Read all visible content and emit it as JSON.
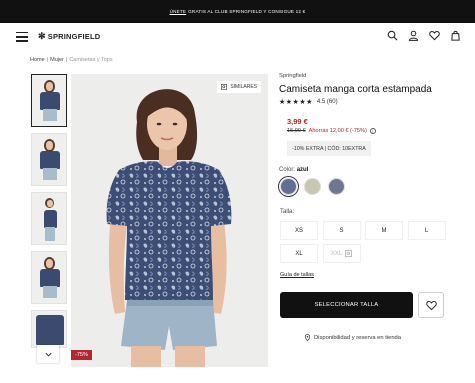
{
  "promo": {
    "link": "ÚNETE",
    "text": "GRATIS AL CLUB SPRINGFIELD Y CONSIGUE 12 €"
  },
  "header": {
    "brand": "SPRINGFIELD",
    "icons": [
      "menu-icon",
      "search-icon",
      "user-icon",
      "heart-icon",
      "bag-icon"
    ]
  },
  "breadcrumb": {
    "items": [
      "Home",
      "Mujer"
    ],
    "current": "Camisetas y Tops"
  },
  "gallery": {
    "similar_label": "SIMILARES",
    "discount_badge": "-75%"
  },
  "product": {
    "brand": "Springfield",
    "title": "Camiseta manga corta estampada",
    "rating_value": "4.5",
    "rating_count": "(60)",
    "stars": "★★★★★",
    "price_now": "3,99 €",
    "price_old": "15,99 €",
    "price_offer": "Ahorras 12,00 € (-75%)",
    "extra_badge": "-10% EXTRA | CÓD: 10EXTRA",
    "color_label": "Color:",
    "color_value": "azul",
    "swatches": [
      {
        "name": "azul",
        "color": "#5f7093"
      },
      {
        "name": "crudo",
        "color": "#c9c7b0"
      },
      {
        "name": "marino",
        "color": "#6f7690"
      }
    ],
    "size_label": "Talla:",
    "sizes": [
      "XS",
      "S",
      "M",
      "L",
      "XL",
      "XXL"
    ],
    "size_guide": "Guía de tallas",
    "cta": "SELECCIONAR TALLA",
    "availability": "Disponibilidad y reserva en tienda"
  },
  "colors": {
    "accent_red": "#b3262f",
    "cta_bg": "#111111"
  }
}
